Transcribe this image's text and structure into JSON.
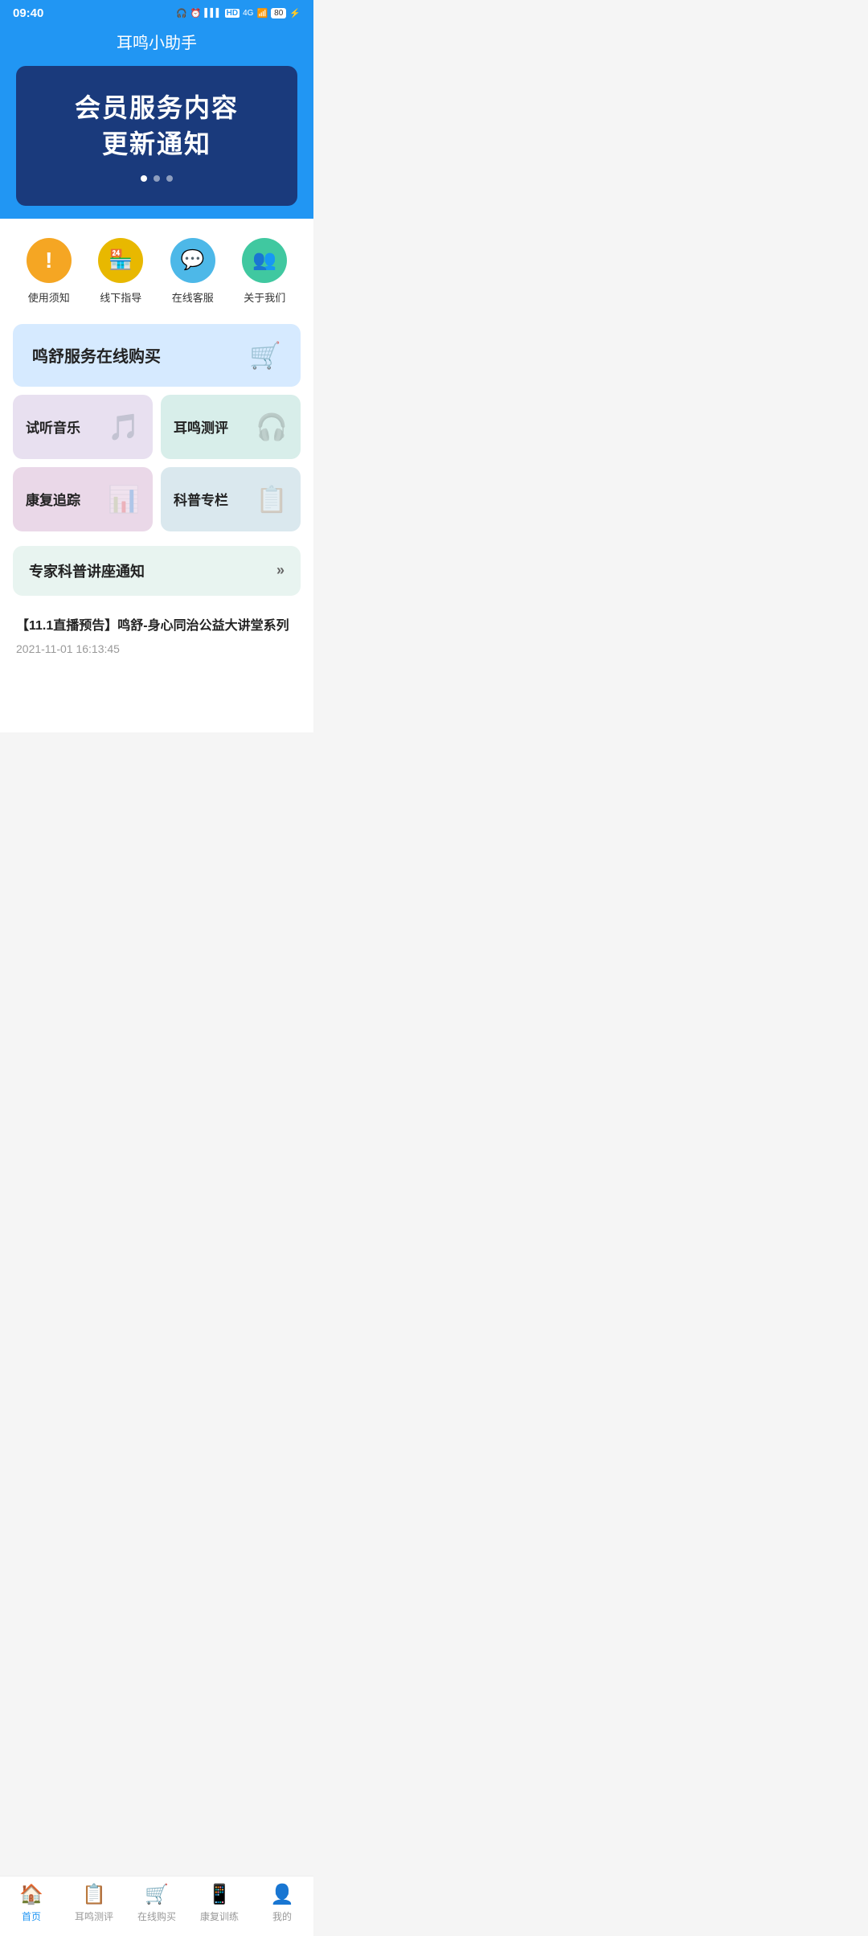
{
  "statusBar": {
    "time": "09:40",
    "icons": "🎧 ⏰ 📶 HD 4G 📶 🔋"
  },
  "header": {
    "title": "耳鸣小助手"
  },
  "banner": {
    "line1": "会员服务内容",
    "line2": "更新通知",
    "dots": [
      true,
      false,
      false
    ]
  },
  "quickActions": [
    {
      "id": "notice",
      "label": "使用须知",
      "icon": "!",
      "color": "#F5A623"
    },
    {
      "id": "offline",
      "label": "线下指导",
      "icon": "🏪",
      "color": "#E8B800"
    },
    {
      "id": "service",
      "label": "在线客服",
      "icon": "💬",
      "color": "#4DB8E8"
    },
    {
      "id": "about",
      "label": "关于我们",
      "icon": "👥",
      "color": "#40C8A0"
    }
  ],
  "serviceCards": {
    "fullCard": {
      "label": "鸣舒服务在线购买",
      "icon": "🛒",
      "bgColor": "#d6eaff"
    },
    "halfCards": [
      {
        "id": "music",
        "label": "试听音乐",
        "icon": "🎵",
        "bgColor": "#e8e0f0"
      },
      {
        "id": "evaluation",
        "label": "耳鸣测评",
        "icon": "🎧",
        "bgColor": "#d8eeea"
      }
    ],
    "halfCards2": [
      {
        "id": "recovery",
        "label": "康复追踪",
        "icon": "📊",
        "bgColor": "#ead8e8"
      },
      {
        "id": "science",
        "label": "科普专栏",
        "icon": "📋",
        "bgColor": "#dae8ee"
      }
    ]
  },
  "notification": {
    "label": "专家科普讲座通知",
    "arrow": "»"
  },
  "article": {
    "title": "【11.1直播预告】鸣舒-身心同治公益大讲堂系列",
    "date": "2021-11-01 16:13:45"
  },
  "bottomNav": [
    {
      "id": "home",
      "label": "首页",
      "icon": "🏠",
      "active": true
    },
    {
      "id": "evaluation",
      "label": "耳鸣测评",
      "icon": "📋",
      "active": false
    },
    {
      "id": "shop",
      "label": "在线购买",
      "icon": "🛒",
      "active": false
    },
    {
      "id": "training",
      "label": "康复训练",
      "icon": "📱",
      "active": false
    },
    {
      "id": "mine",
      "label": "我的",
      "icon": "👤",
      "active": false
    }
  ]
}
